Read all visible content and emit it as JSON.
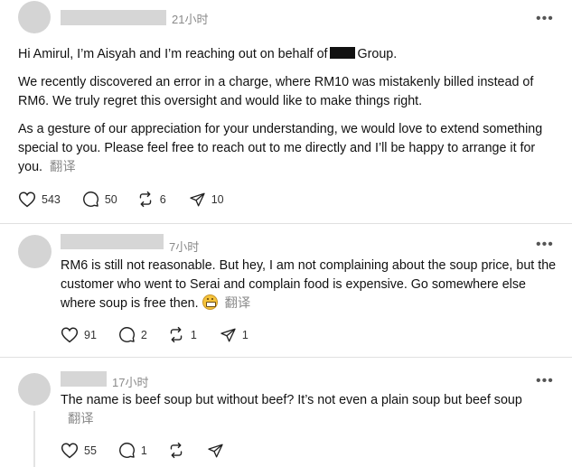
{
  "posts": [
    {
      "timestamp": "21小时",
      "paragraphs": [
        "Hi Amirul, I’m Aisyah and I’m reaching out on behalf of",
        "Group.",
        "We recently discovered an error in a charge, where RM10 was mistakenly billed instead of RM6. We truly regret this oversight and would like to make things right.",
        "As a gesture of our appreciation for your understanding, we would love to extend something special to you. Please feel free to reach out to me directly and I’ll be happy to arrange it for you."
      ],
      "translate": "翻译",
      "likes": "543",
      "replies": "50",
      "reposts": "6",
      "shares": "10"
    },
    {
      "timestamp": "7小时",
      "text": "RM6 is still not reasonable. But hey, I am not complaining about the soup price, but the customer who went to Serai and complain food is expensive. Go somewhere else where soup is free then.",
      "emoji": "grimacing-face",
      "translate": "翻译",
      "likes": "91",
      "replies": "2",
      "reposts": "1",
      "shares": "1"
    },
    {
      "timestamp": "17小时",
      "text": "The name is beef soup but without beef? It’s not even a plain soup but beef soup",
      "translate": "翻译",
      "likes": "55",
      "replies": "1",
      "reposts": "",
      "shares": ""
    }
  ],
  "more_label": "•••",
  "icons": {
    "like": "heart-icon",
    "reply": "comment-icon",
    "repost": "repost-icon",
    "share": "send-icon"
  }
}
